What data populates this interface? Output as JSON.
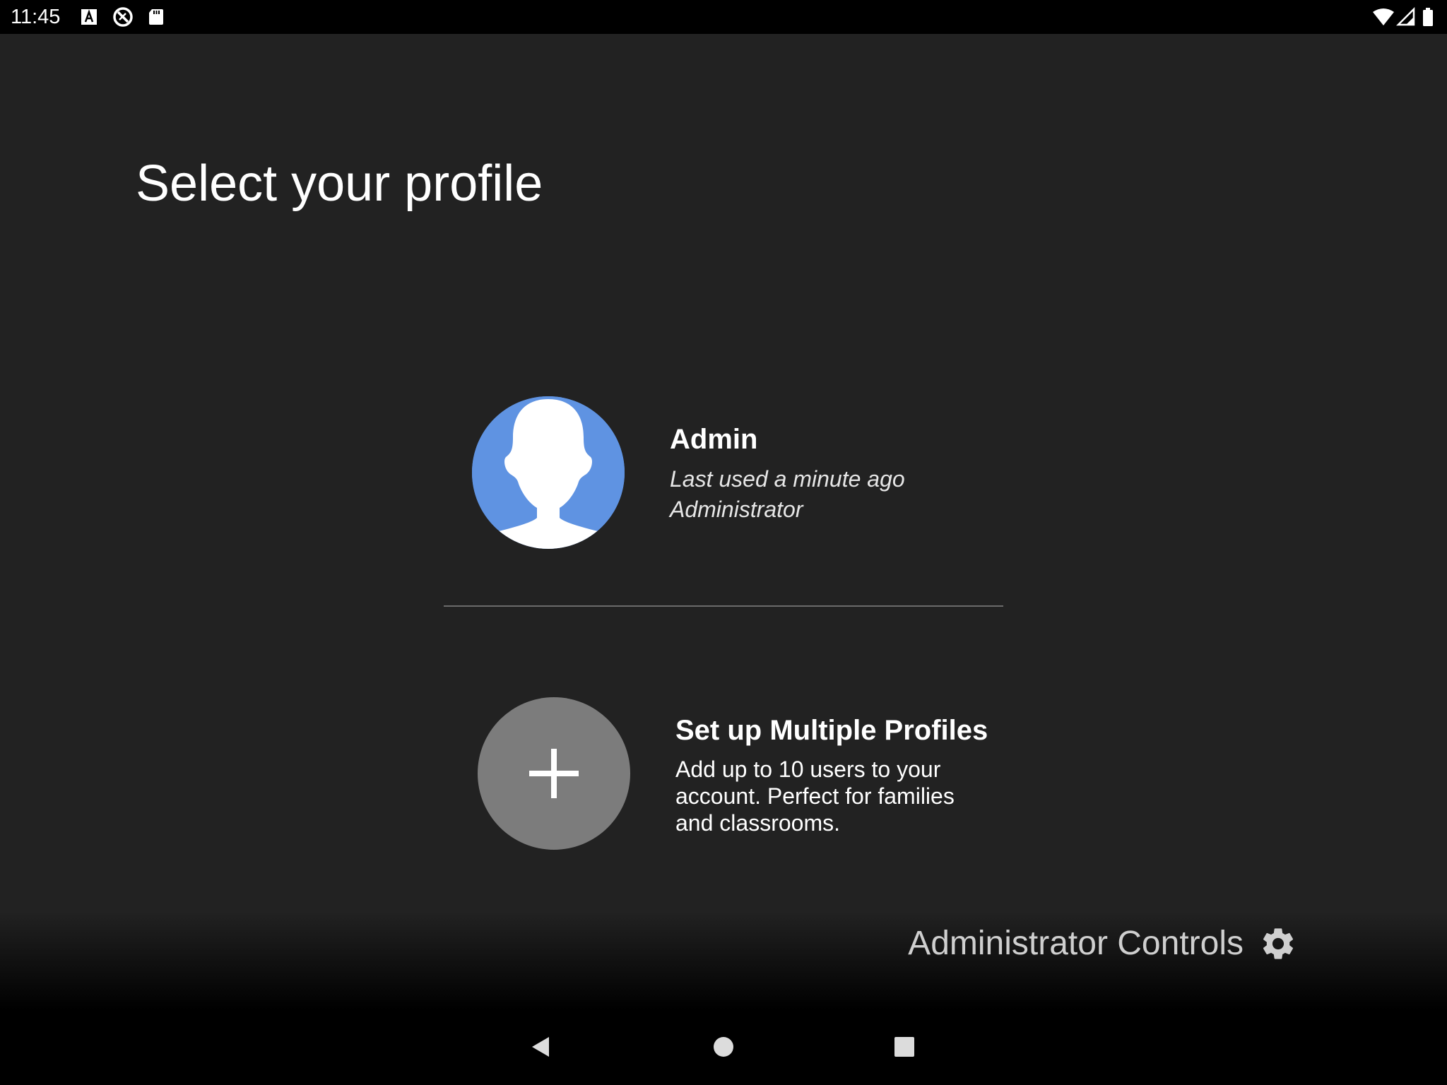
{
  "status_bar": {
    "time": "11:45",
    "left_icons": [
      "text-a-icon",
      "no-sync-icon",
      "sd-card-icon"
    ],
    "right_icons": [
      "wifi-icon",
      "cell-signal-icon",
      "battery-icon"
    ]
  },
  "page": {
    "title": "Select your profile"
  },
  "profile": {
    "name": "Admin",
    "last_used": "Last used a minute ago",
    "role": "Administrator",
    "avatar_color": "#5f93e2"
  },
  "setup": {
    "title": "Set up Multiple Profiles",
    "description": "Add up to 10 users to your account. Perfect for families and classrooms.",
    "icon": "plus-icon"
  },
  "admin_controls": {
    "label": "Administrator Controls",
    "icon": "gear-icon"
  },
  "nav_bar": {
    "buttons": [
      "back-icon",
      "home-icon",
      "recents-icon"
    ]
  }
}
